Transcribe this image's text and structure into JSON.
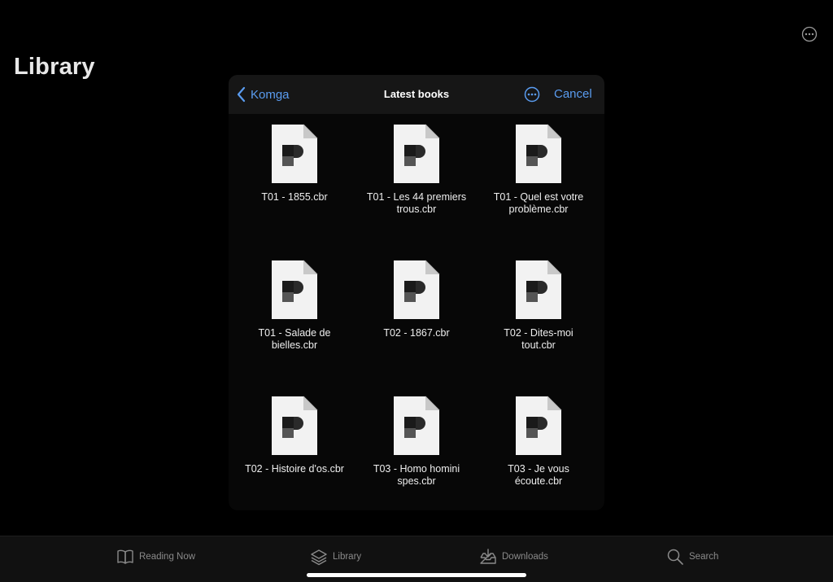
{
  "page": {
    "title": "Library"
  },
  "modal": {
    "back_label": "Komga",
    "title": "Latest books",
    "cancel_label": "Cancel"
  },
  "files": [
    {
      "name": "T01 - 1855.cbr"
    },
    {
      "name": "T01 - Les 44 premiers trous.cbr"
    },
    {
      "name": "T01 - Quel est votre problème.cbr"
    },
    {
      "name": "T01 - Salade de bielles.cbr"
    },
    {
      "name": "T02 - 1867.cbr"
    },
    {
      "name": "T02 - Dites-moi tout.cbr"
    },
    {
      "name": "T02 - Histoire d'os.cbr"
    },
    {
      "name": "T03 - Homo homini spes.cbr"
    },
    {
      "name": "T03 - Je vous écoute.cbr"
    }
  ],
  "tab_bar": {
    "reading_now": "Reading Now",
    "library": "Library",
    "downloads": "Downloads",
    "search": "Search"
  },
  "icons": {
    "top_more": "ellipsis-circle-icon",
    "back": "chevron-left-icon",
    "modal_more": "ellipsis-circle-icon",
    "file": "document-icon",
    "reading_now": "book-icon",
    "library": "stack-icon",
    "downloads": "tray-download-icon",
    "search": "magnifier-icon"
  },
  "colors": {
    "accent": "#5a9cf0",
    "background": "#000000",
    "modal_header": "#161616",
    "tab_label": "#8a8a8a"
  }
}
